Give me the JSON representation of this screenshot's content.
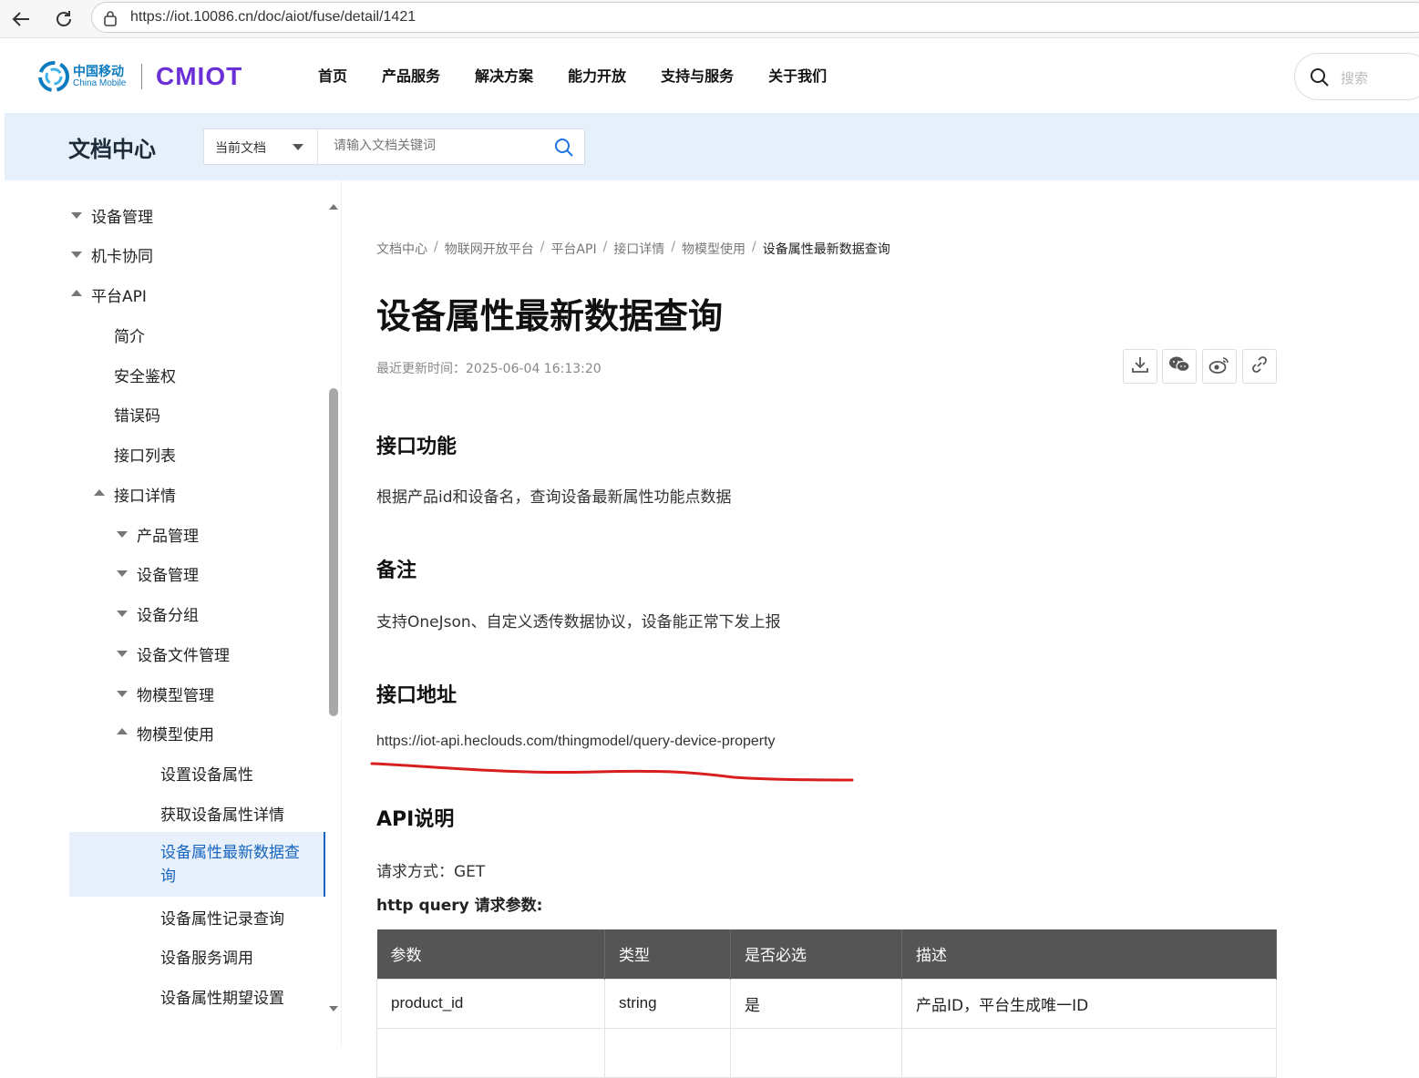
{
  "browser": {
    "url": "https://iot.10086.cn/doc/aiot/fuse/detail/1421"
  },
  "header": {
    "logo_cn": "中国移动",
    "logo_en": "China Mobile",
    "logo_brand": "CMIOT",
    "nav": [
      "首页",
      "产品服务",
      "解决方案",
      "能力开放",
      "支持与服务",
      "关于我们"
    ],
    "search_placeholder": "搜索"
  },
  "doc_banner": {
    "title": "文档中心",
    "scope_label": "当前文档",
    "search_placeholder": "请输入文档关键词"
  },
  "sidebar": {
    "items": [
      {
        "label": "设备管理",
        "state": "collapsed"
      },
      {
        "label": "机卡协同",
        "state": "collapsed"
      },
      {
        "label": "平台API",
        "state": "expanded"
      },
      {
        "label": "简介"
      },
      {
        "label": "安全鉴权"
      },
      {
        "label": "错误码"
      },
      {
        "label": "接口列表"
      },
      {
        "label": "接口详情",
        "state": "expanded"
      },
      {
        "label": "产品管理",
        "state": "collapsed"
      },
      {
        "label": "设备管理",
        "state": "collapsed"
      },
      {
        "label": "设备分组",
        "state": "collapsed"
      },
      {
        "label": "设备文件管理",
        "state": "collapsed"
      },
      {
        "label": "物模型管理",
        "state": "collapsed"
      },
      {
        "label": "物模型使用",
        "state": "expanded"
      },
      {
        "label": "设置设备属性"
      },
      {
        "label": "获取设备属性详情"
      },
      {
        "label": "设备属性最新数据查询",
        "active": true
      },
      {
        "label": "设备属性记录查询"
      },
      {
        "label": "设备服务调用"
      },
      {
        "label": "设备属性期望设置"
      }
    ]
  },
  "content": {
    "breadcrumb": [
      "文档中心",
      "物联网开放平台",
      "平台API",
      "接口详情",
      "物模型使用",
      "设备属性最新数据查询"
    ],
    "title": "设备属性最新数据查询",
    "updated": "最近更新时间：2025-06-04 16:13:20",
    "share_icons": [
      "download-icon",
      "wechat-icon",
      "weibo-icon",
      "link-icon"
    ],
    "sections": {
      "func_title": "接口功能",
      "func_text": "根据产品id和设备名，查询设备最新属性功能点数据",
      "note_title": "备注",
      "note_text": "支持OneJson、自定义透传数据协议，设备能正常下发上报",
      "addr_title": "接口地址",
      "addr_url": "https://iot-api.heclouds.com/thingmodel/query-device-property",
      "api_title": "API说明",
      "method": "请求方式：GET",
      "params_title": "http query 请求参数:"
    },
    "table": {
      "headers": [
        "参数",
        "类型",
        "是否必选",
        "描述"
      ],
      "rows": [
        [
          "product_id",
          "string",
          "是",
          "产品ID，平台生成唯一ID"
        ]
      ]
    }
  },
  "colors": {
    "brand_blue": "#0c7bc0",
    "brand_purple": "#6b2fd6",
    "banner_bg": "#e6f0fb",
    "active_blue": "#1565c0",
    "annotation_red": "#d81e1e",
    "table_header": "#555555"
  }
}
